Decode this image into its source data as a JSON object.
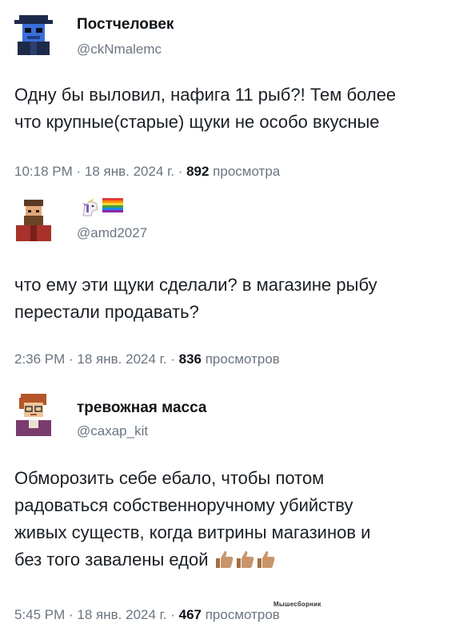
{
  "tweets": [
    {
      "name": "Постчеловек",
      "handle": "@ckNmalemc",
      "text_lines": [
        "Одну бы выловил, нафига 11 рыб?! Тем более",
        "что крупные(старые) щуки не особо вкусные"
      ],
      "time": "10:18 PM · 18 янв. 2024 г. · ",
      "views": "892",
      "views_label": " просмотра"
    },
    {
      "name": "",
      "name_emoji": [
        "unicorn-emoji",
        "rainbow-flag-emoji"
      ],
      "handle": "@amd2027",
      "text_lines": [
        "что ему эти щуки сделали? в магазине рыбу",
        "перестали продавать?"
      ],
      "time": "2:36 PM · 18 янв. 2024 г. · ",
      "views": "836",
      "views_label": " просмотров"
    },
    {
      "name": "тревожная масса",
      "handle": "@caxap_kit",
      "text_lines": [
        "Обморозить себе ебало, чтобы потом",
        "радоваться собственноручному убийству",
        "живых существ, когда витрины магазинов и",
        "без того завалены едой"
      ],
      "trailing_emoji": [
        "thumbs-up-icon",
        "thumbs-up-icon",
        "thumbs-up-icon"
      ],
      "time": "5:45 PM · 18 янв. 2024 г. · ",
      "views": "467",
      "views_label": " просмотров"
    }
  ],
  "watermark": "Мышесборник",
  "colors": {
    "text": "#0f1419",
    "secondary": "#6b7580",
    "thumb": "#c8956a"
  }
}
